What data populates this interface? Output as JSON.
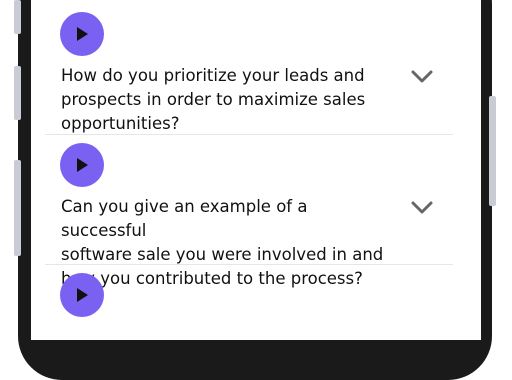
{
  "faq": {
    "items": [
      {
        "question": "How do you prioritize your leads and\nprospects in order to maximize sales\nopportunities?",
        "play_icon": "play-icon",
        "expand_icon": "chevron-down-icon"
      },
      {
        "question": "Can you give an example of a successful\nsoftware sale you were involved in and\nhow you contributed to the process?",
        "play_icon": "play-icon",
        "expand_icon": "chevron-down-icon"
      },
      {
        "question": "",
        "play_icon": "play-icon",
        "expand_icon": "chevron-down-icon"
      }
    ]
  },
  "colors": {
    "accent": "#7b61f2",
    "chevron": "#666666",
    "divider": "#e6e6ea",
    "text": "#111111"
  }
}
